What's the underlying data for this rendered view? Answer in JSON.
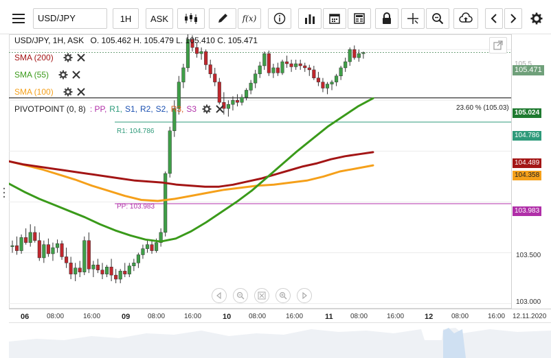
{
  "toolbar": {
    "symbol": "USD/JPY",
    "timeframe": "1H",
    "price_type": "ASK",
    "icons": [
      "menu-icon",
      "candles-icon",
      "pencil-icon",
      "function-icon",
      "info-icon",
      "bar-chart-icon",
      "calendar-icon",
      "news-icon",
      "lock-icon",
      "crosshair-icon",
      "zoom-icon",
      "upload-icon",
      "chevron-left-icon",
      "chevron-right-icon",
      "gear-icon"
    ]
  },
  "legend": {
    "title": "USD/JPY, 1H, ASK",
    "ohlc": "O. 105.462 H. 105.479 L. 105.410 C. 105.471",
    "sma200": "SMA (200)",
    "sma55": "SMA (55)",
    "sma100": "SMA (100)",
    "pivot_name": "PIVOTPOINT (0, 8)",
    "pivot_items": [
      {
        "label": ": PP,",
        "color": "#b02fa8"
      },
      {
        "label": "R1,",
        "color": "#2e9a7a"
      },
      {
        "label": "S1,",
        "color": "#1a4fb0"
      },
      {
        "label": "R2,",
        "color": "#1a4fb0"
      },
      {
        "label": "S2,",
        "color": "#1a4fb0"
      },
      {
        "label": "R3,",
        "color": "#d4581c"
      },
      {
        "label": "S3",
        "color": "#b02fa8"
      }
    ]
  },
  "colors": {
    "up": "#3f9f48",
    "down": "#c0272d",
    "sma200": "#a31515",
    "sma55": "#3a9a1a",
    "sma100": "#f5a01a",
    "pp": "#b02fa8",
    "r1": "#2e9a7a",
    "fib": "#000000"
  },
  "lines": {
    "fib_label": "23.60 % (105.03)",
    "r1_label": "R1: 104.786",
    "pp_label": "PP: 103.983"
  },
  "price_tags": {
    "current": "105.471",
    "partial": "105.5",
    "fib": "105.024",
    "r1": "104.786",
    "sma200": "104.489",
    "sma100": "104.358",
    "pp": "103.983"
  },
  "y_axis": {
    "labels": [
      "103.500",
      "103.000"
    ]
  },
  "x_axis": [
    {
      "label": "06",
      "bold": true
    },
    {
      "label": "08:00",
      "bold": false
    },
    {
      "label": "16:00",
      "bold": false
    },
    {
      "label": "09",
      "bold": true
    },
    {
      "label": "08:00",
      "bold": false
    },
    {
      "label": "16:00",
      "bold": false
    },
    {
      "label": "10",
      "bold": true
    },
    {
      "label": "08:00",
      "bold": false
    },
    {
      "label": "16:00",
      "bold": false
    },
    {
      "label": "11",
      "bold": true
    },
    {
      "label": "08:00",
      "bold": false
    },
    {
      "label": "16:00",
      "bold": false
    },
    {
      "label": "12",
      "bold": true
    },
    {
      "label": "08:00",
      "bold": false
    },
    {
      "label": "16:00",
      "bold": false
    },
    {
      "label": "12.11.2020",
      "bold": false
    }
  ],
  "chart_data": {
    "type": "candlestick",
    "symbol": "USD/JPY",
    "timeframe": "1H",
    "ylim": [
      102.95,
      105.65
    ],
    "horizontal_lines": [
      {
        "name": "23.60 % (105.03)",
        "value": 105.024
      },
      {
        "name": "R1",
        "value": 104.786
      },
      {
        "name": "PP",
        "value": 103.983
      },
      {
        "name": "Last",
        "value": 105.471
      }
    ],
    "candles": [
      [
        103.56,
        103.62,
        103.5,
        103.57
      ],
      [
        103.57,
        103.66,
        103.48,
        103.52
      ],
      [
        103.52,
        103.68,
        103.49,
        103.65
      ],
      [
        103.65,
        103.74,
        103.58,
        103.6
      ],
      [
        103.6,
        103.78,
        103.56,
        103.7
      ],
      [
        103.7,
        103.76,
        103.6,
        103.62
      ],
      [
        103.62,
        103.7,
        103.42,
        103.45
      ],
      [
        103.45,
        103.62,
        103.4,
        103.58
      ],
      [
        103.58,
        103.64,
        103.46,
        103.49
      ],
      [
        103.49,
        103.6,
        103.42,
        103.55
      ],
      [
        103.55,
        103.63,
        103.5,
        103.59
      ],
      [
        103.59,
        103.62,
        103.43,
        103.46
      ],
      [
        103.46,
        103.55,
        103.35,
        103.4
      ],
      [
        103.4,
        103.46,
        103.24,
        103.29
      ],
      [
        103.29,
        103.4,
        103.22,
        103.35
      ],
      [
        103.35,
        103.42,
        103.26,
        103.31
      ],
      [
        103.31,
        103.66,
        103.28,
        103.62
      ],
      [
        103.62,
        103.7,
        103.3,
        103.34
      ],
      [
        103.34,
        103.42,
        103.26,
        103.38
      ],
      [
        103.38,
        103.44,
        103.3,
        103.33
      ],
      [
        103.33,
        103.4,
        103.24,
        103.29
      ],
      [
        103.29,
        103.38,
        103.26,
        103.36
      ],
      [
        103.36,
        103.44,
        103.22,
        103.28
      ],
      [
        103.28,
        103.34,
        103.2,
        103.24
      ],
      [
        103.24,
        103.34,
        103.2,
        103.32
      ],
      [
        103.32,
        103.4,
        103.26,
        103.29
      ],
      [
        103.29,
        103.4,
        103.26,
        103.37
      ],
      [
        103.37,
        103.44,
        103.32,
        103.4
      ],
      [
        103.4,
        103.5,
        103.35,
        103.48
      ],
      [
        103.48,
        103.58,
        103.44,
        103.54
      ],
      [
        103.54,
        103.63,
        103.5,
        103.58
      ],
      [
        103.58,
        103.62,
        103.49,
        103.52
      ],
      [
        103.52,
        103.64,
        103.5,
        103.6
      ],
      [
        103.6,
        103.74,
        103.56,
        103.7
      ],
      [
        103.7,
        104.3,
        103.66,
        104.28
      ],
      [
        104.28,
        104.74,
        104.24,
        104.7
      ],
      [
        104.7,
        105.0,
        104.64,
        104.92
      ],
      [
        104.92,
        105.24,
        104.86,
        105.18
      ],
      [
        105.18,
        105.36,
        105.12,
        105.32
      ],
      [
        105.32,
        105.66,
        105.28,
        105.6
      ],
      [
        105.6,
        105.64,
        105.48,
        105.52
      ],
      [
        105.52,
        105.56,
        105.42,
        105.46
      ],
      [
        105.46,
        105.52,
        105.4,
        105.48
      ],
      [
        105.48,
        105.5,
        105.3,
        105.35
      ],
      [
        105.35,
        105.4,
        105.22,
        105.26
      ],
      [
        105.26,
        105.32,
        105.14,
        105.18
      ],
      [
        105.18,
        105.22,
        104.96,
        104.98
      ],
      [
        104.98,
        105.08,
        104.86,
        104.92
      ],
      [
        104.92,
        105.0,
        104.84,
        104.96
      ],
      [
        104.96,
        105.04,
        104.9,
        105.0
      ],
      [
        105.0,
        105.06,
        104.94,
        104.98
      ],
      [
        104.98,
        105.06,
        104.95,
        105.03
      ],
      [
        105.03,
        105.12,
        105.0,
        105.1
      ],
      [
        105.1,
        105.2,
        105.06,
        105.17
      ],
      [
        105.17,
        105.3,
        105.12,
        105.26
      ],
      [
        105.26,
        105.38,
        105.22,
        105.34
      ],
      [
        105.34,
        105.48,
        105.3,
        105.46
      ],
      [
        105.46,
        105.49,
        105.24,
        105.27
      ],
      [
        105.27,
        105.36,
        105.22,
        105.32
      ],
      [
        105.32,
        105.37,
        105.24,
        105.27
      ],
      [
        105.27,
        105.4,
        105.25,
        105.38
      ],
      [
        105.38,
        105.44,
        105.32,
        105.36
      ],
      [
        105.36,
        105.4,
        105.28,
        105.33
      ],
      [
        105.33,
        105.4,
        105.3,
        105.36
      ],
      [
        105.36,
        105.4,
        105.3,
        105.34
      ],
      [
        105.34,
        105.37,
        105.28,
        105.32
      ],
      [
        105.32,
        105.35,
        105.24,
        105.3
      ],
      [
        105.3,
        105.34,
        105.2,
        105.22
      ],
      [
        105.22,
        105.28,
        105.14,
        105.18
      ],
      [
        105.18,
        105.22,
        105.08,
        105.12
      ],
      [
        105.12,
        105.18,
        105.06,
        105.16
      ],
      [
        105.16,
        105.2,
        105.1,
        105.18
      ],
      [
        105.18,
        105.26,
        105.14,
        105.24
      ],
      [
        105.24,
        105.34,
        105.2,
        105.32
      ],
      [
        105.32,
        105.42,
        105.28,
        105.38
      ],
      [
        105.38,
        105.52,
        105.34,
        105.5
      ],
      [
        105.5,
        105.54,
        105.4,
        105.42
      ],
      [
        105.42,
        105.5,
        105.38,
        105.46
      ],
      [
        105.46,
        105.48,
        105.41,
        105.47
      ]
    ],
    "sma200": [
      104.4,
      104.37,
      104.35,
      104.33,
      104.31,
      104.29,
      104.27,
      104.25,
      104.23,
      104.21,
      104.2,
      104.19,
      104.17,
      104.16,
      104.15,
      104.15,
      104.17,
      104.2,
      104.23,
      104.27,
      104.31,
      104.35,
      104.38,
      104.42,
      104.45,
      104.47,
      104.49
    ],
    "sma55": [
      104.18,
      104.1,
      104.03,
      103.97,
      103.91,
      103.85,
      103.78,
      103.72,
      103.67,
      103.63,
      103.61,
      103.64,
      103.71,
      103.8,
      103.9,
      104.0,
      104.11,
      104.24,
      104.37,
      104.5,
      104.62,
      104.74,
      104.84,
      104.94,
      105.02
    ],
    "sma100": [
      104.4,
      104.36,
      104.32,
      104.27,
      104.22,
      104.16,
      104.11,
      104.06,
      104.02,
      104.01,
      104.03,
      104.06,
      104.09,
      104.12,
      104.14,
      104.16,
      104.17,
      104.19,
      104.21,
      104.25,
      104.3,
      104.33,
      104.36
    ]
  }
}
